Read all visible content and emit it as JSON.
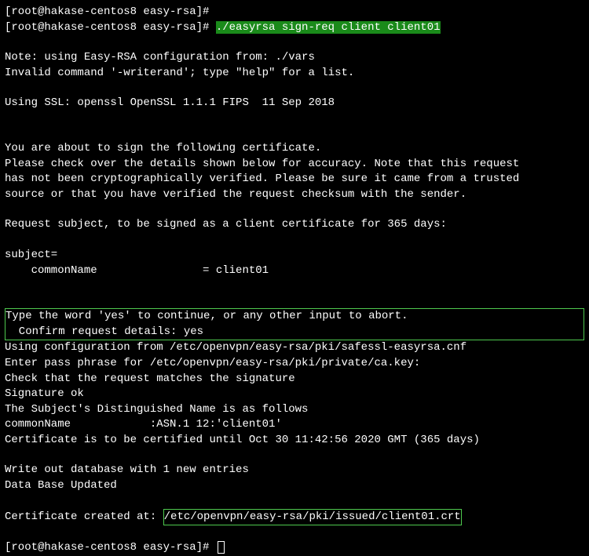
{
  "prompt1": "[root@hakase-centos8 easy-rsa]#",
  "prompt2": "[root@hakase-centos8 easy-rsa]# ",
  "command": "./easyrsa sign-req client client01",
  "note": "Note: using Easy-RSA configuration from: ./vars",
  "invalidCmd": "Invalid command '-writerand'; type \"help\" for a list.",
  "ssl": "Using SSL: openssl OpenSSL 1.1.1 FIPS  11 Sep 2018",
  "sign1": "You are about to sign the following certificate.",
  "sign2": "Please check over the details shown below for accuracy. Note that this request",
  "sign3": "has not been cryptographically verified. Please be sure it came from a trusted",
  "sign4": "source or that you have verified the request checksum with the sender.",
  "reqSubject": "Request subject, to be signed as a client certificate for 365 days:",
  "subjectLine": "subject=",
  "cn": "    commonName                = client01",
  "confirm1": "Type the word 'yes' to continue, or any other input to abort.",
  "confirm2": "  Confirm request details: yes",
  "cfg": "Using configuration from /etc/openvpn/easy-rsa/pki/safessl-easyrsa.cnf",
  "pass": "Enter pass phrase for /etc/openvpn/easy-rsa/pki/private/ca.key:",
  "check": "Check that the request matches the signature",
  "sigOk": "Signature ok",
  "dn": "The Subject's Distinguished Name is as follows",
  "cnAsn": "commonName            :ASN.1 12:'client01'",
  "certUntil": "Certificate is to be certified until Oct 30 11:42:56 2020 GMT (365 days)",
  "writeDb": "Write out database with 1 new entries",
  "dbUpdated": "Data Base Updated",
  "certCreatedPrefix": "Certificate created at: ",
  "certCreatedPath": "/etc/openvpn/easy-rsa/pki/issued/client01.crt",
  "prompt3": "[root@hakase-centos8 easy-rsa]# "
}
